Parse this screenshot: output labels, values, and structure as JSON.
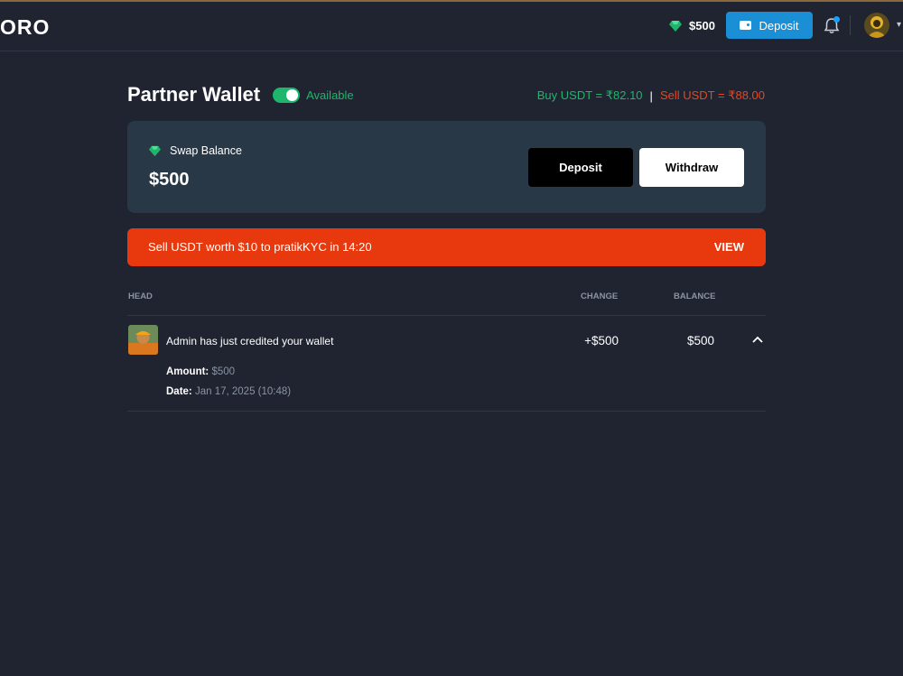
{
  "header": {
    "logo": "ORO",
    "balance": "$500",
    "deposit_label": "Deposit"
  },
  "page": {
    "title": "Partner Wallet",
    "status": "Available",
    "buy_rate": "Buy USDT = ₹82.10",
    "separator": "|",
    "sell_rate": "Sell USDT = ₹88.00"
  },
  "balance_card": {
    "label": "Swap Balance",
    "amount": "$500",
    "deposit_label": "Deposit",
    "withdraw_label": "Withdraw"
  },
  "alert": {
    "text": "Sell USDT worth $10 to pratikKYC in 14:20",
    "action": "VIEW"
  },
  "table": {
    "columns": [
      "HEAD",
      "CHANGE",
      "BALANCE"
    ],
    "rows": [
      {
        "description": "Admin has just credited your wallet",
        "change": "+$500",
        "balance": "$500",
        "amount_label": "Amount:",
        "amount_value": "$500",
        "date_label": "Date:",
        "date_value": "Jan 17, 2025 (10:48)"
      }
    ]
  },
  "colors": {
    "background": "#1f2430",
    "card": "#283847",
    "accent_blue": "#1a8fd6",
    "green": "#1db66b",
    "red": "#e8461e",
    "alert": "#e8390e"
  },
  "icons": [
    "gem-icon",
    "wallet-icon",
    "bell-icon",
    "chevron-down-icon",
    "chevron-up-icon"
  ]
}
